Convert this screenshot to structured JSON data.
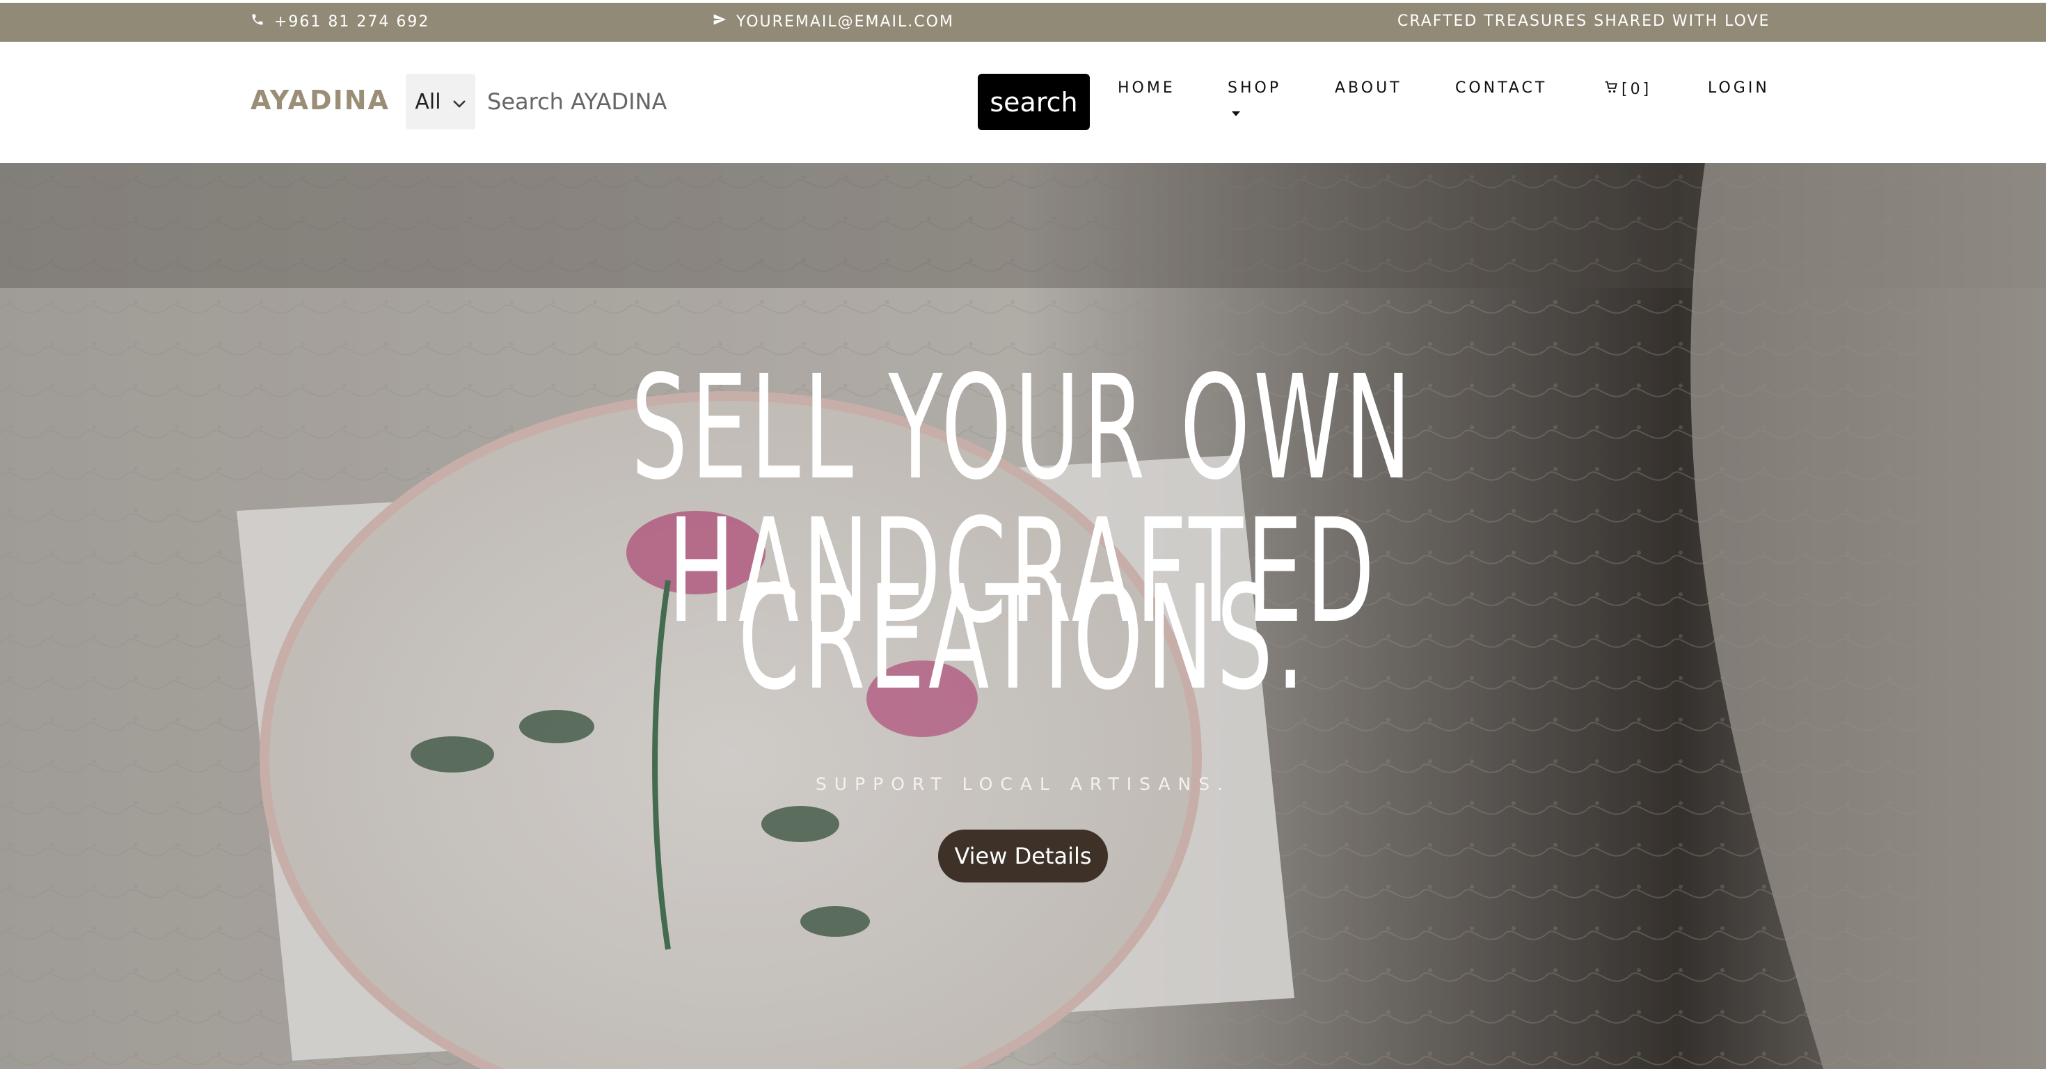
{
  "topbar": {
    "phone": "+961 81 274 692",
    "email": "YOUREMAIL@EMAIL.COM",
    "tagline": "CRAFTED TREASURES SHARED WITH LOVE"
  },
  "header": {
    "logo": "AYADINA",
    "category_select": "All",
    "search_placeholder": "Search AYADINA",
    "search_button": "search",
    "nav": {
      "home": "HOME",
      "shop": "SHOP",
      "about": "ABOUT",
      "contact": "CONTACT",
      "cart": "[0]",
      "login": "LOGIN"
    }
  },
  "hero": {
    "title_line1": "Sell your own handcrafted",
    "title_line2": "creations.",
    "subtitle": "SUPPORT LOCAL ARTISANS.",
    "button": "View Details"
  },
  "colors": {
    "topbar_bg": "#918a76",
    "logo": "#9a8e77",
    "hero_button": "#3d3128"
  },
  "icons": {
    "phone": "phone-icon",
    "email": "paper-plane-icon",
    "cart": "cart-icon",
    "select_chevron": "chevron-down-icon"
  }
}
